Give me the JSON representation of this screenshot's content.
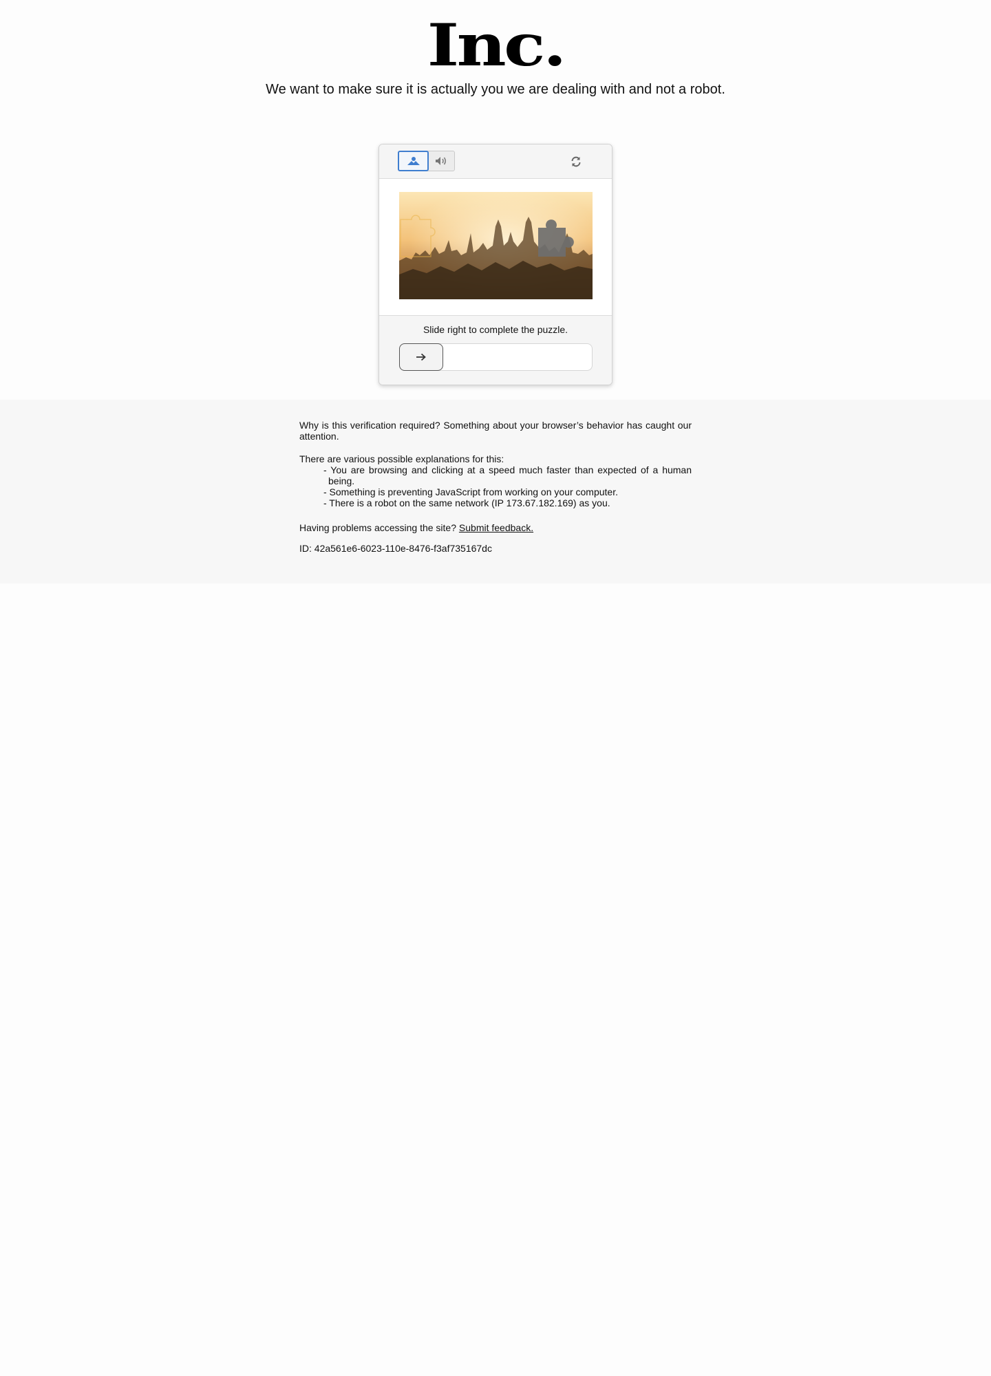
{
  "brand": {
    "logo_text": "Inc."
  },
  "header": {
    "tagline": "We want to make sure it is actually you we are dealing with and not a robot."
  },
  "captcha": {
    "mode_image_icon": "image-icon",
    "mode_audio_icon": "speaker-icon",
    "refresh_icon": "refresh-icon",
    "instruction": "Slide right to complete the puzzle.",
    "slider_icon": "arrow-right-icon",
    "slider_progress": 0,
    "accent_color": "#3f7ecf"
  },
  "info": {
    "why": "Why is this verification required? Something about your browser’s behavior has caught our attention.",
    "reasons_intro": "There are various possible explanations for this:",
    "reasons": [
      "- You are browsing and clicking at a speed much faster than expected of a human being.",
      "- Something is preventing JavaScript from working on your computer.",
      "- There is a robot on the same network (IP 173.67.182.169) as you."
    ],
    "problems_text": "Having problems accessing the site?",
    "feedback_link": "Submit feedback.",
    "id_text": "ID: 42a561e6-6023-110e-8476-f3af735167dc"
  }
}
